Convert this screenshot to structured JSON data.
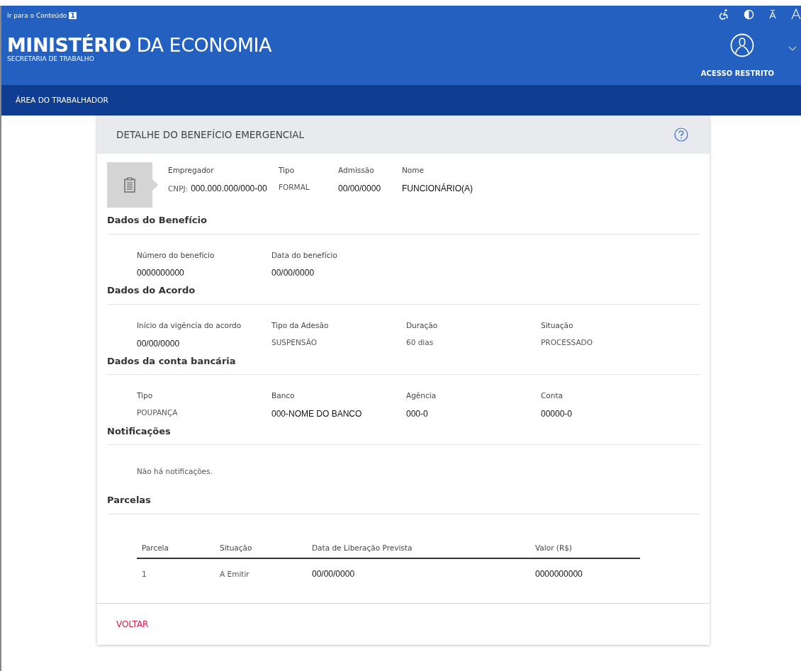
{
  "header": {
    "skip_link": {
      "text": "Ir para o Conteúdo",
      "key": "1"
    },
    "title_bold": "MINISTÉRIO",
    "title_rest": "DA ECONOMIA",
    "subtitle": "SECRETARIA DE TRABALHO",
    "access_label": "ACESSO RESTRITO"
  },
  "nav": {
    "items": [
      {
        "label": "ÁREA DO TRABALHADOR"
      }
    ]
  },
  "card": {
    "title": "DETALHE DO BENEFÍCIO EMERGENCIAL",
    "summary": [
      {
        "label": "Empregador",
        "prefix": "CNPJ:",
        "value": "000.000.000/000-00",
        "kind": "strong"
      },
      {
        "label": "Tipo",
        "value": "FORMAL",
        "kind": "plain"
      },
      {
        "label": "Admissão",
        "value": "00/00/0000",
        "kind": "strong"
      },
      {
        "label": "Nome",
        "value": "FUNCIONÁRIO(A)",
        "kind": "strong"
      }
    ],
    "sections": [
      {
        "kind": "fields",
        "title": "Dados do Benefício",
        "fields": [
          {
            "label": "Número do benefício",
            "value": "0000000000",
            "kind": "strong"
          },
          {
            "label": "Data do benefício",
            "value": "00/00/0000",
            "kind": "strong"
          }
        ]
      },
      {
        "kind": "fields",
        "title": "Dados do Acordo",
        "fields": [
          {
            "label": "Início da vigência do acordo",
            "value": "00/00/0000",
            "kind": "strong"
          },
          {
            "label": "Tipo da Adesão",
            "value": "SUSPENSÃO",
            "kind": "plain"
          },
          {
            "label": "Duração",
            "value": "60 dias",
            "kind": "plain"
          },
          {
            "label": "Situação",
            "value": "PROCESSADO",
            "kind": "plain"
          }
        ]
      },
      {
        "kind": "fields",
        "title": "Dados da conta bancária",
        "fields": [
          {
            "label": "Tipo",
            "value": "POUPANÇA",
            "kind": "plain"
          },
          {
            "label": "Banco",
            "value": "000-NOME DO BANCO",
            "kind": "strong"
          },
          {
            "label": "Agência",
            "value": "000-0",
            "kind": "strong"
          },
          {
            "label": "Conta",
            "value": "00000-0",
            "kind": "strong"
          }
        ]
      },
      {
        "kind": "text",
        "title": "Notificações",
        "text": "Não há notificações."
      },
      {
        "kind": "table",
        "title": "Parcelas",
        "columns": [
          "Parcela",
          "Situação",
          "Data de Liberação Prevista",
          "Valor (R$)"
        ],
        "rows": [
          [
            {
              "value": "1",
              "kind": "plain"
            },
            {
              "value": "A Emitir",
              "kind": "plain"
            },
            {
              "value": "00/00/0000",
              "kind": "strong"
            },
            {
              "value": "0000000000",
              "kind": "strong"
            }
          ]
        ]
      }
    ],
    "back_button": "VOLTAR"
  }
}
